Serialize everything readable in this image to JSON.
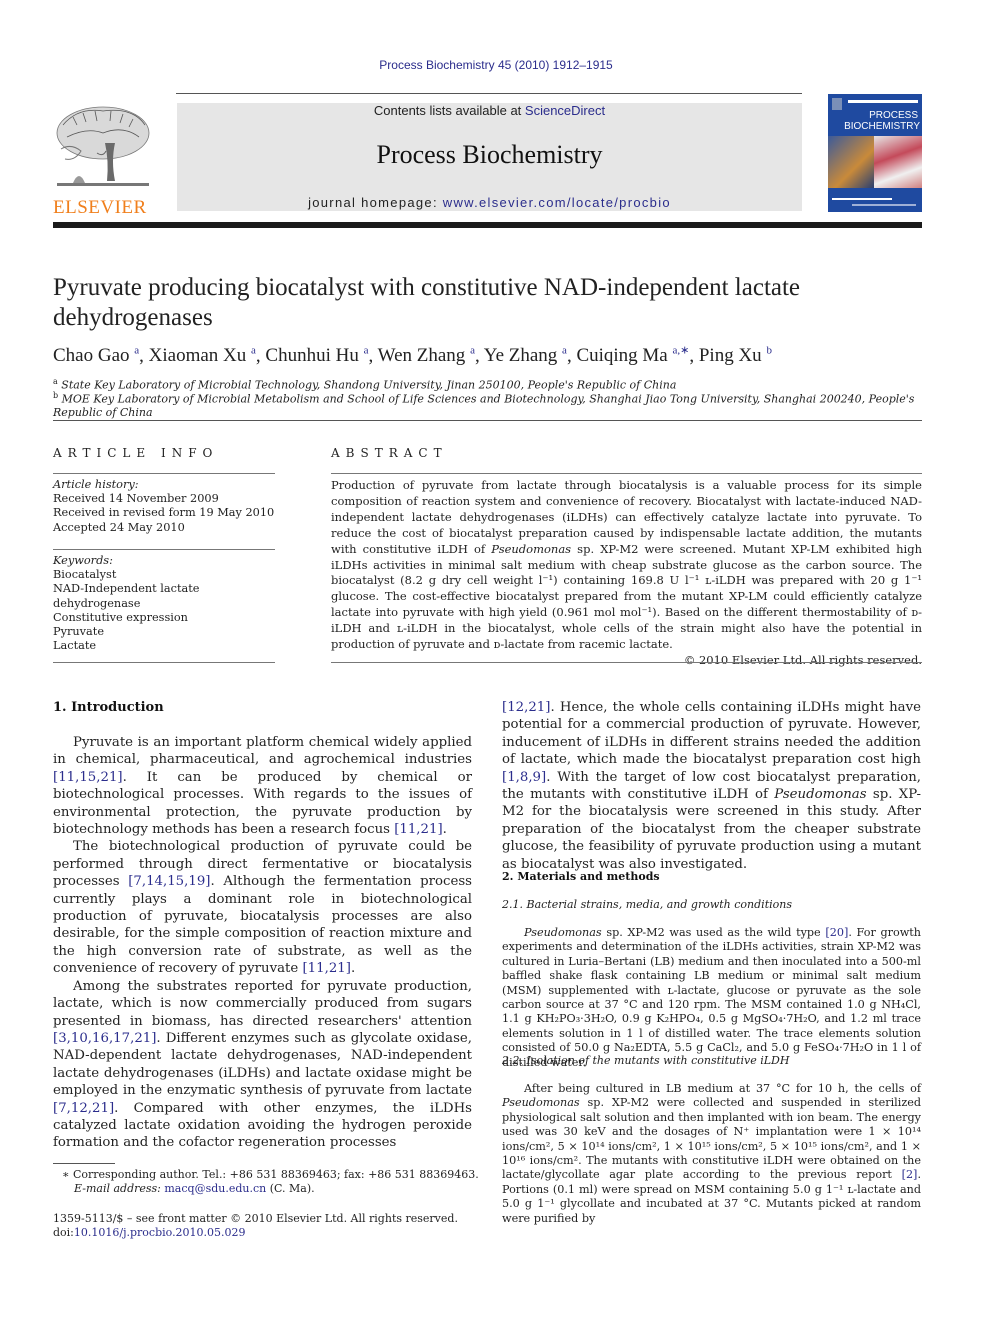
{
  "header": {
    "citation": "Process Biochemistry 45 (2010) 1912–1915",
    "contents_prefix": "Contents lists available at ",
    "contents_link": "ScienceDirect",
    "journal_title": "Process Biochemistry",
    "homepage_prefix": "journal homepage: ",
    "homepage_link": "www.elsevier.com/locate/procbio",
    "publisher_logo_text": "ELSEVIER",
    "publisher_logo_color": "#f07f1c",
    "cover": {
      "line1": "PROCESS",
      "line2": "BIOCHEMISTRY",
      "color": "#1f4aa0"
    }
  },
  "paper": {
    "title": "Pyruvate producing biocatalyst with constitutive NAD-independent lactate dehydrogenases",
    "authors": [
      {
        "name": "Chao Gao",
        "affil": "a"
      },
      {
        "name": "Xiaoman Xu",
        "affil": "a"
      },
      {
        "name": "Chunhui Hu",
        "affil": "a"
      },
      {
        "name": "Wen Zhang",
        "affil": "a"
      },
      {
        "name": "Ye Zhang",
        "affil": "a"
      },
      {
        "name": "Cuiqing Ma",
        "affil": "a,∗"
      },
      {
        "name": "Ping Xu",
        "affil": "b"
      }
    ],
    "affiliations": [
      {
        "mark": "a",
        "text": "State Key Laboratory of Microbial Technology, Shandong University, Jinan 250100, People's Republic of China"
      },
      {
        "mark": "b",
        "text": "MOE Key Laboratory of Microbial Metabolism and School of Life Sciences and Biotechnology, Shanghai Jiao Tong University, Shanghai 200240, People's Republic of China"
      }
    ]
  },
  "article_info": {
    "heading": "ARTICLE INFO",
    "history_label": "Article history:",
    "history": [
      "Received 14 November 2009",
      "Received in revised form 19 May 2010",
      "Accepted 24 May 2010"
    ],
    "keywords_label": "Keywords:",
    "keywords": [
      "Biocatalyst",
      "NAD-Independent lactate dehydrogenase",
      "Constitutive expression",
      "Pyruvate",
      "Lactate"
    ]
  },
  "abstract": {
    "heading": "ABSTRACT",
    "text_1": "Production of pyruvate from lactate through biocatalysis is a valuable process for its simple composition of reaction system and convenience of recovery. Biocatalyst with lactate-induced NAD-independent lactate dehydrogenases (iLDHs) can effectively catalyze lactate into pyruvate. To reduce the cost of biocatalyst preparation caused by indispensable lactate addition, the mutants with constitutive iLDH of ",
    "text_italic": "Pseudomonas",
    "text_2": " sp. XP-M2 were screened. Mutant XP-LM exhibited high iLDHs activities in minimal salt medium with cheap substrate glucose as the carbon source. The biocatalyst (8.2 g dry cell weight l⁻¹) containing 169.8 U l⁻¹ ʟ-iLDH was prepared with 20 g 1⁻¹ glucose. The cost-effective biocatalyst prepared from the mutant XP-LM could efficiently catalyze lactate into pyruvate with high yield (0.961 mol mol⁻¹). Based on the different thermostability of ᴅ-iLDH and ʟ-iLDH in the biocatalyst, whole cells of the strain might also have the potential in production of pyruvate and ᴅ-lactate from racemic lactate.",
    "copyright": "© 2010 Elsevier Ltd. All rights reserved."
  },
  "intro": {
    "heading": "1.  Introduction",
    "p1_a": "Pyruvate is an important platform chemical widely applied in chemical, pharmaceutical, and agrochemical industries ",
    "p1_ref1": "[11,15,21]",
    "p1_b": ". It can be produced by chemical or biotechnological processes. With regards to the issues of environmental protection, the pyruvate production by biotechnology methods has been a research focus ",
    "p1_ref2": "[11,21]",
    "p1_c": ".",
    "p2_a": "The biotechnological production of pyruvate could be performed through direct fermentative or biocatalysis processes ",
    "p2_ref1": "[7,14,15,19]",
    "p2_b": ". Although the fermentation process currently plays a dominant role in biotechnological production of pyruvate, biocatalysis processes are also desirable, for the simple composition of reaction mixture and the high conversion rate of substrate, as well as the convenience of recovery of pyruvate ",
    "p2_ref2": "[11,21]",
    "p2_c": ".",
    "p3_a": "Among the substrates reported for pyruvate production, lactate, which is now commercially produced from sugars presented in biomass, has directed researchers' attention ",
    "p3_ref1": "[3,10,16,17,21]",
    "p3_b": ". Different enzymes such as glycolate oxidase, NAD-dependent lactate dehydrogenases, NAD-independent lactate dehydrogenases (iLDHs) and lactate oxidase might be employed in the enzymatic synthesis of pyruvate from lactate ",
    "p3_ref2": "[7,12,21]",
    "p3_c": ". Compared with other enzymes, the iLDHs catalyzed lactate oxidation avoiding the hydrogen peroxide formation and the cofactor regeneration processes",
    "p4_ref1": "[12,21]",
    "p4_a": ". Hence, the whole cells containing iLDHs might have potential for a commercial production of pyruvate. However, inducement of iLDHs in different strains needed the addition of lactate, which made the biocatalyst preparation cost high ",
    "p4_ref2": "[1,8,9]",
    "p4_b": ". With the target of low cost biocatalyst preparation, the mutants with constitutive iLDH of ",
    "p4_italic": "Pseudomonas",
    "p4_c": " sp. XP-M2 for the biocatalysis were screened in this study. After preparation of the biocatalyst from the cheaper substrate glucose, the feasibility of pyruvate production using a mutant as biocatalyst was also investigated."
  },
  "methods": {
    "heading": "2.  Materials and methods",
    "sub1_heading": "2.1.   Bacterial strains, media, and growth conditions",
    "sub1_italic": "Pseudomonas",
    "sub1_a": " sp. XP-M2 was used as the wild type ",
    "sub1_ref": "[20]",
    "sub1_b": ". For growth experiments and determination of the iLDHs activities, strain XP-M2 was cultured in Luria–Bertani (LB) medium and then inoculated into a 500-ml baffled shake flask containing LB medium or minimal salt medium (MSM) supplemented with ʟ-lactate, glucose or pyruvate as the sole carbon source at 37 °C and 120 rpm. The MSM contained 1.0 g NH₄Cl, 1.1 g KH₂PO₃·3H₂O, 0.9 g K₂HPO₄, 0.5 g MgSO₄·7H₂O, and 1.2 ml trace elements solution in 1 l of distilled water. The trace elements solution consisted of 50.0 g Na₂EDTA, 5.5 g CaCl₂, and 5.0 g FeSO₄·7H₂O in 1 l of distilled water.",
    "sub2_heading": "2.2.   Isolation of the mutants with constitutive iLDH",
    "sub2_a": "After being cultured in LB medium at 37 °C for 10 h, the cells of ",
    "sub2_italic": "Pseudomonas",
    "sub2_b": " sp. XP-M2 were collected and suspended in sterilized physiological salt solution and then implanted with ion beam. The energy used was 30 keV and the dosages of N⁺ implantation were 1 × 10¹⁴ ions/cm², 5 × 10¹⁴ ions/cm², 1 × 10¹⁵ ions/cm², 5 × 10¹⁵ ions/cm², and 1 × 10¹⁶ ions/cm². The mutants with constitutive iLDH were obtained on the lactate/glycollate agar plate according to the previous report ",
    "sub2_ref": "[2]",
    "sub2_c": ". Portions (0.1 ml) were spread on MSM containing 5.0 g 1⁻¹ ʟ-lactate and 5.0 g 1⁻¹ glycollate and incubated at 37 °C. Mutants picked at random were purified by"
  },
  "footnotes": {
    "corresponding": "∗  Corresponding author. Tel.: +86 531 88369463; fax: +86 531 88369463.",
    "email_label": "E-mail address: ",
    "email": "macq@sdu.edu.cn",
    "email_suffix": " (C. Ma).",
    "issn": "1359-5113/$ – see front matter © 2010 Elsevier Ltd. All rights reserved.",
    "doi_prefix": "doi:",
    "doi": "10.1016/j.procbio.2010.05.029"
  }
}
